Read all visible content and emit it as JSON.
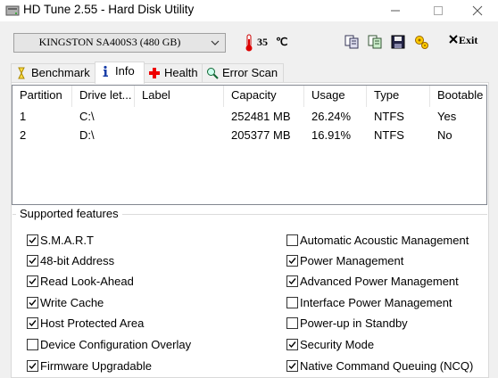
{
  "window": {
    "title": "HD Tune 2.55 - Hard Disk Utility"
  },
  "toolbar": {
    "drive": "KINGSTON SA400S3 (480 GB)",
    "temperature": "35",
    "temp_unit": "℃",
    "exit_label": "Exit"
  },
  "tabs": [
    {
      "label": "Benchmark",
      "icon": "benchmark-icon"
    },
    {
      "label": "Info",
      "icon": "info-icon",
      "active": true
    },
    {
      "label": "Health",
      "icon": "health-icon"
    },
    {
      "label": "Error Scan",
      "icon": "magnifier-icon"
    }
  ],
  "partitions": {
    "columns": [
      "Partition",
      "Drive let...",
      "Label",
      "Capacity",
      "Usage",
      "Type",
      "Bootable"
    ],
    "rows": [
      {
        "partition": "1",
        "drive": "C:\\",
        "label": "",
        "capacity": "252481 MB",
        "usage": "26.24%",
        "type": "NTFS",
        "bootable": "Yes"
      },
      {
        "partition": "2",
        "drive": "D:\\",
        "label": "",
        "capacity": "205377 MB",
        "usage": "16.91%",
        "type": "NTFS",
        "bootable": "No"
      }
    ]
  },
  "features": {
    "title": "Supported features",
    "left": [
      {
        "label": "S.M.A.R.T",
        "checked": true
      },
      {
        "label": "48-bit Address",
        "checked": true
      },
      {
        "label": "Read Look-Ahead",
        "checked": true
      },
      {
        "label": "Write Cache",
        "checked": true
      },
      {
        "label": "Host Protected Area",
        "checked": true
      },
      {
        "label": "Device Configuration Overlay",
        "checked": false
      },
      {
        "label": "Firmware Upgradable",
        "checked": true
      }
    ],
    "right": [
      {
        "label": "Automatic Acoustic Management",
        "checked": false
      },
      {
        "label": "Power Management",
        "checked": true
      },
      {
        "label": "Advanced Power Management",
        "checked": true
      },
      {
        "label": "Interface Power Management",
        "checked": false
      },
      {
        "label": "Power-up in Standby",
        "checked": false
      },
      {
        "label": "Security Mode",
        "checked": true
      },
      {
        "label": "Native Command Queuing (NCQ)",
        "checked": true
      }
    ]
  }
}
